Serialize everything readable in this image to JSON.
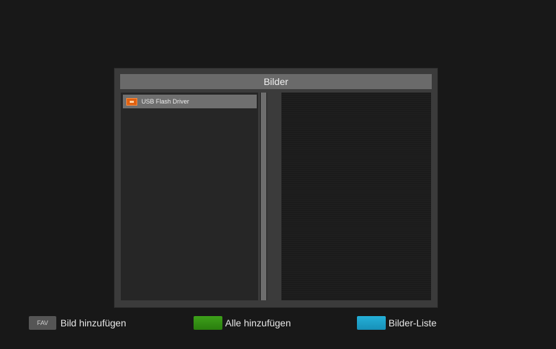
{
  "dialog": {
    "title": "Bilder",
    "list_items": [
      {
        "icon": "usb-drive-icon",
        "label": "USB Flash Driver",
        "selected": true
      }
    ]
  },
  "footer": {
    "fav_key_label": "FAV",
    "fav_hint": "Bild hinzufügen",
    "green_hint": "Alle hinzufügen",
    "blue_hint": "Bilder-Liste"
  },
  "colors": {
    "green_key": "#3ea11a",
    "blue_key": "#24b0d8",
    "usb_icon": "#e06010",
    "selection": "#6f6f6f"
  }
}
